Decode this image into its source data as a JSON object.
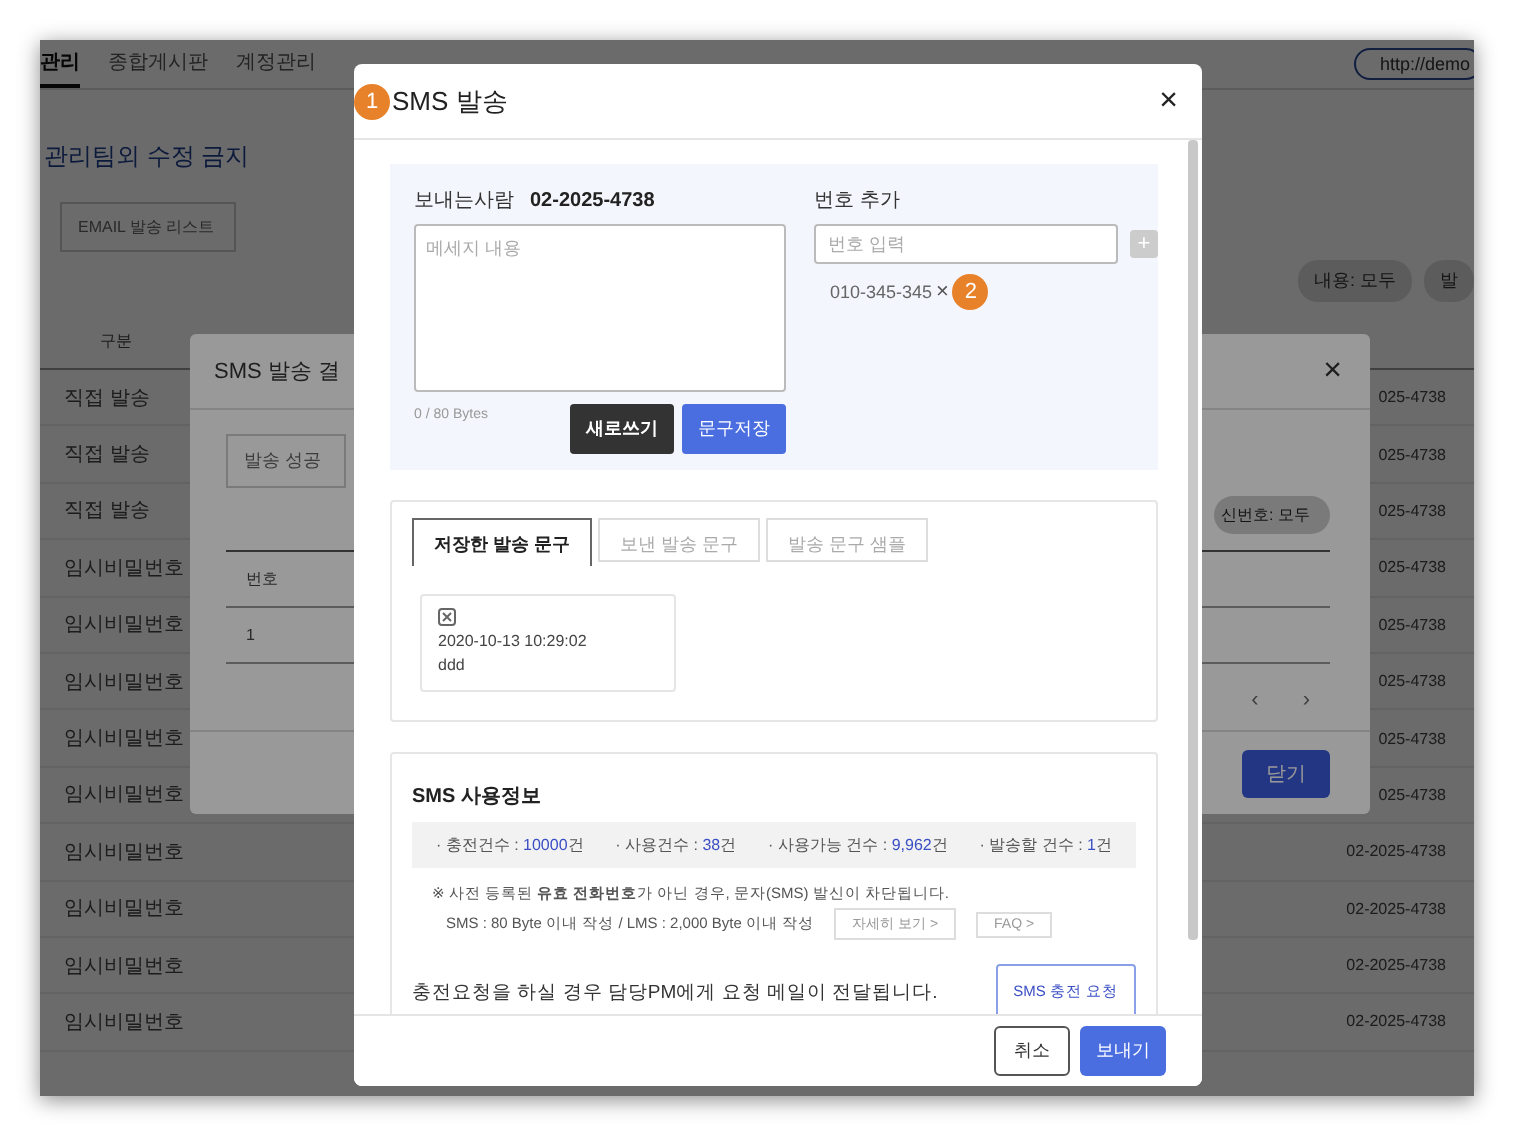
{
  "nav": {
    "items": [
      {
        "label": "관리",
        "selected": true
      },
      {
        "label": "종합게시판",
        "selected": false
      },
      {
        "label": "계정관리",
        "selected": false
      }
    ],
    "url": "http://demo"
  },
  "page": {
    "heading": "관리팀외 수정 금지",
    "list_button": "EMAIL 발송 리스트",
    "filters": [
      "내용: 모두",
      "발"
    ],
    "columns": [
      "구분"
    ],
    "rows": [
      {
        "type": "직접 발송",
        "phone": "025-4738"
      },
      {
        "type": "직접 발송",
        "phone": "025-4738"
      },
      {
        "type": "직접 발송",
        "phone": "025-4738"
      },
      {
        "type": "임시비밀번호",
        "phone": "025-4738"
      },
      {
        "type": "임시비밀번호",
        "phone": "025-4738"
      },
      {
        "type": "임시비밀번호",
        "phone": "025-4738"
      },
      {
        "type": "임시비밀번호",
        "phone": "025-4738"
      },
      {
        "type": "임시비밀번호",
        "phone": "025-4738"
      },
      {
        "type": "임시비밀번호",
        "phone": "02-2025-4738"
      },
      {
        "type": "임시비밀번호",
        "phone": "02-2025-4738"
      },
      {
        "type": "임시비밀번호",
        "phone": "02-2025-4738"
      },
      {
        "type": "임시비밀번호",
        "phone": "02-2025-4738"
      }
    ]
  },
  "result_modal": {
    "title": "SMS 발송 결",
    "close": "×",
    "tab": "발송 성공",
    "filter": "신번호: 모두",
    "columns": [
      "번호"
    ],
    "rows": [
      "1"
    ],
    "pager": [
      "‹",
      "›"
    ],
    "button": "닫기"
  },
  "sms_modal": {
    "badge": "1",
    "title": "SMS 발송",
    "close": "×",
    "sender_label": "보내는사람",
    "sender": "02-2025-4738",
    "message_placeholder": "메세지 내용",
    "bytes": "0 / 80 Bytes",
    "reset_button": "새로쓰기",
    "save_button": "문구저장",
    "add_label": "번호 추가",
    "number_placeholder": "번호 입력",
    "add_button": "+",
    "recipients": [
      {
        "number": "010-345-345",
        "remove": "×",
        "badge": "2"
      }
    ],
    "tabs": [
      {
        "label": "저장한 발송 문구",
        "selected": true
      },
      {
        "label": "보낸 발송 문구",
        "selected": false
      },
      {
        "label": "발송 문구 샘플",
        "selected": false
      }
    ],
    "saved": [
      {
        "date": "2020-10-13 10:29:02",
        "text": "ddd"
      }
    ],
    "info_title": "SMS 사용정보",
    "stats": [
      {
        "label": "· 충전건수 : ",
        "value": "10000",
        "unit": "건"
      },
      {
        "label": "· 사용건수 : ",
        "value": "38",
        "unit": "건"
      },
      {
        "label": "· 사용가능 건수 : ",
        "value": "9,962",
        "unit": "건"
      },
      {
        "label": "· 발송할 건수 : ",
        "value": "1",
        "unit": "건"
      }
    ],
    "notice": "※ 사전 등록된 **유효 전화번호**가 아닌 경우, 문자(SMS) 발신이 차단됩니다.",
    "limits": "SMS : 80 Byte 이내 작성 / LMS : 2,000 Byte 이내 작성",
    "detail_button": "자세히 보기 >",
    "faq_button": "FAQ >",
    "charge_text": "충전요청을 하실 경우 담당PM에게 요청 메일이 전달됩니다.",
    "charge_button": "SMS 충전 요청",
    "cancel_button": "취소",
    "send_button": "보내기"
  }
}
